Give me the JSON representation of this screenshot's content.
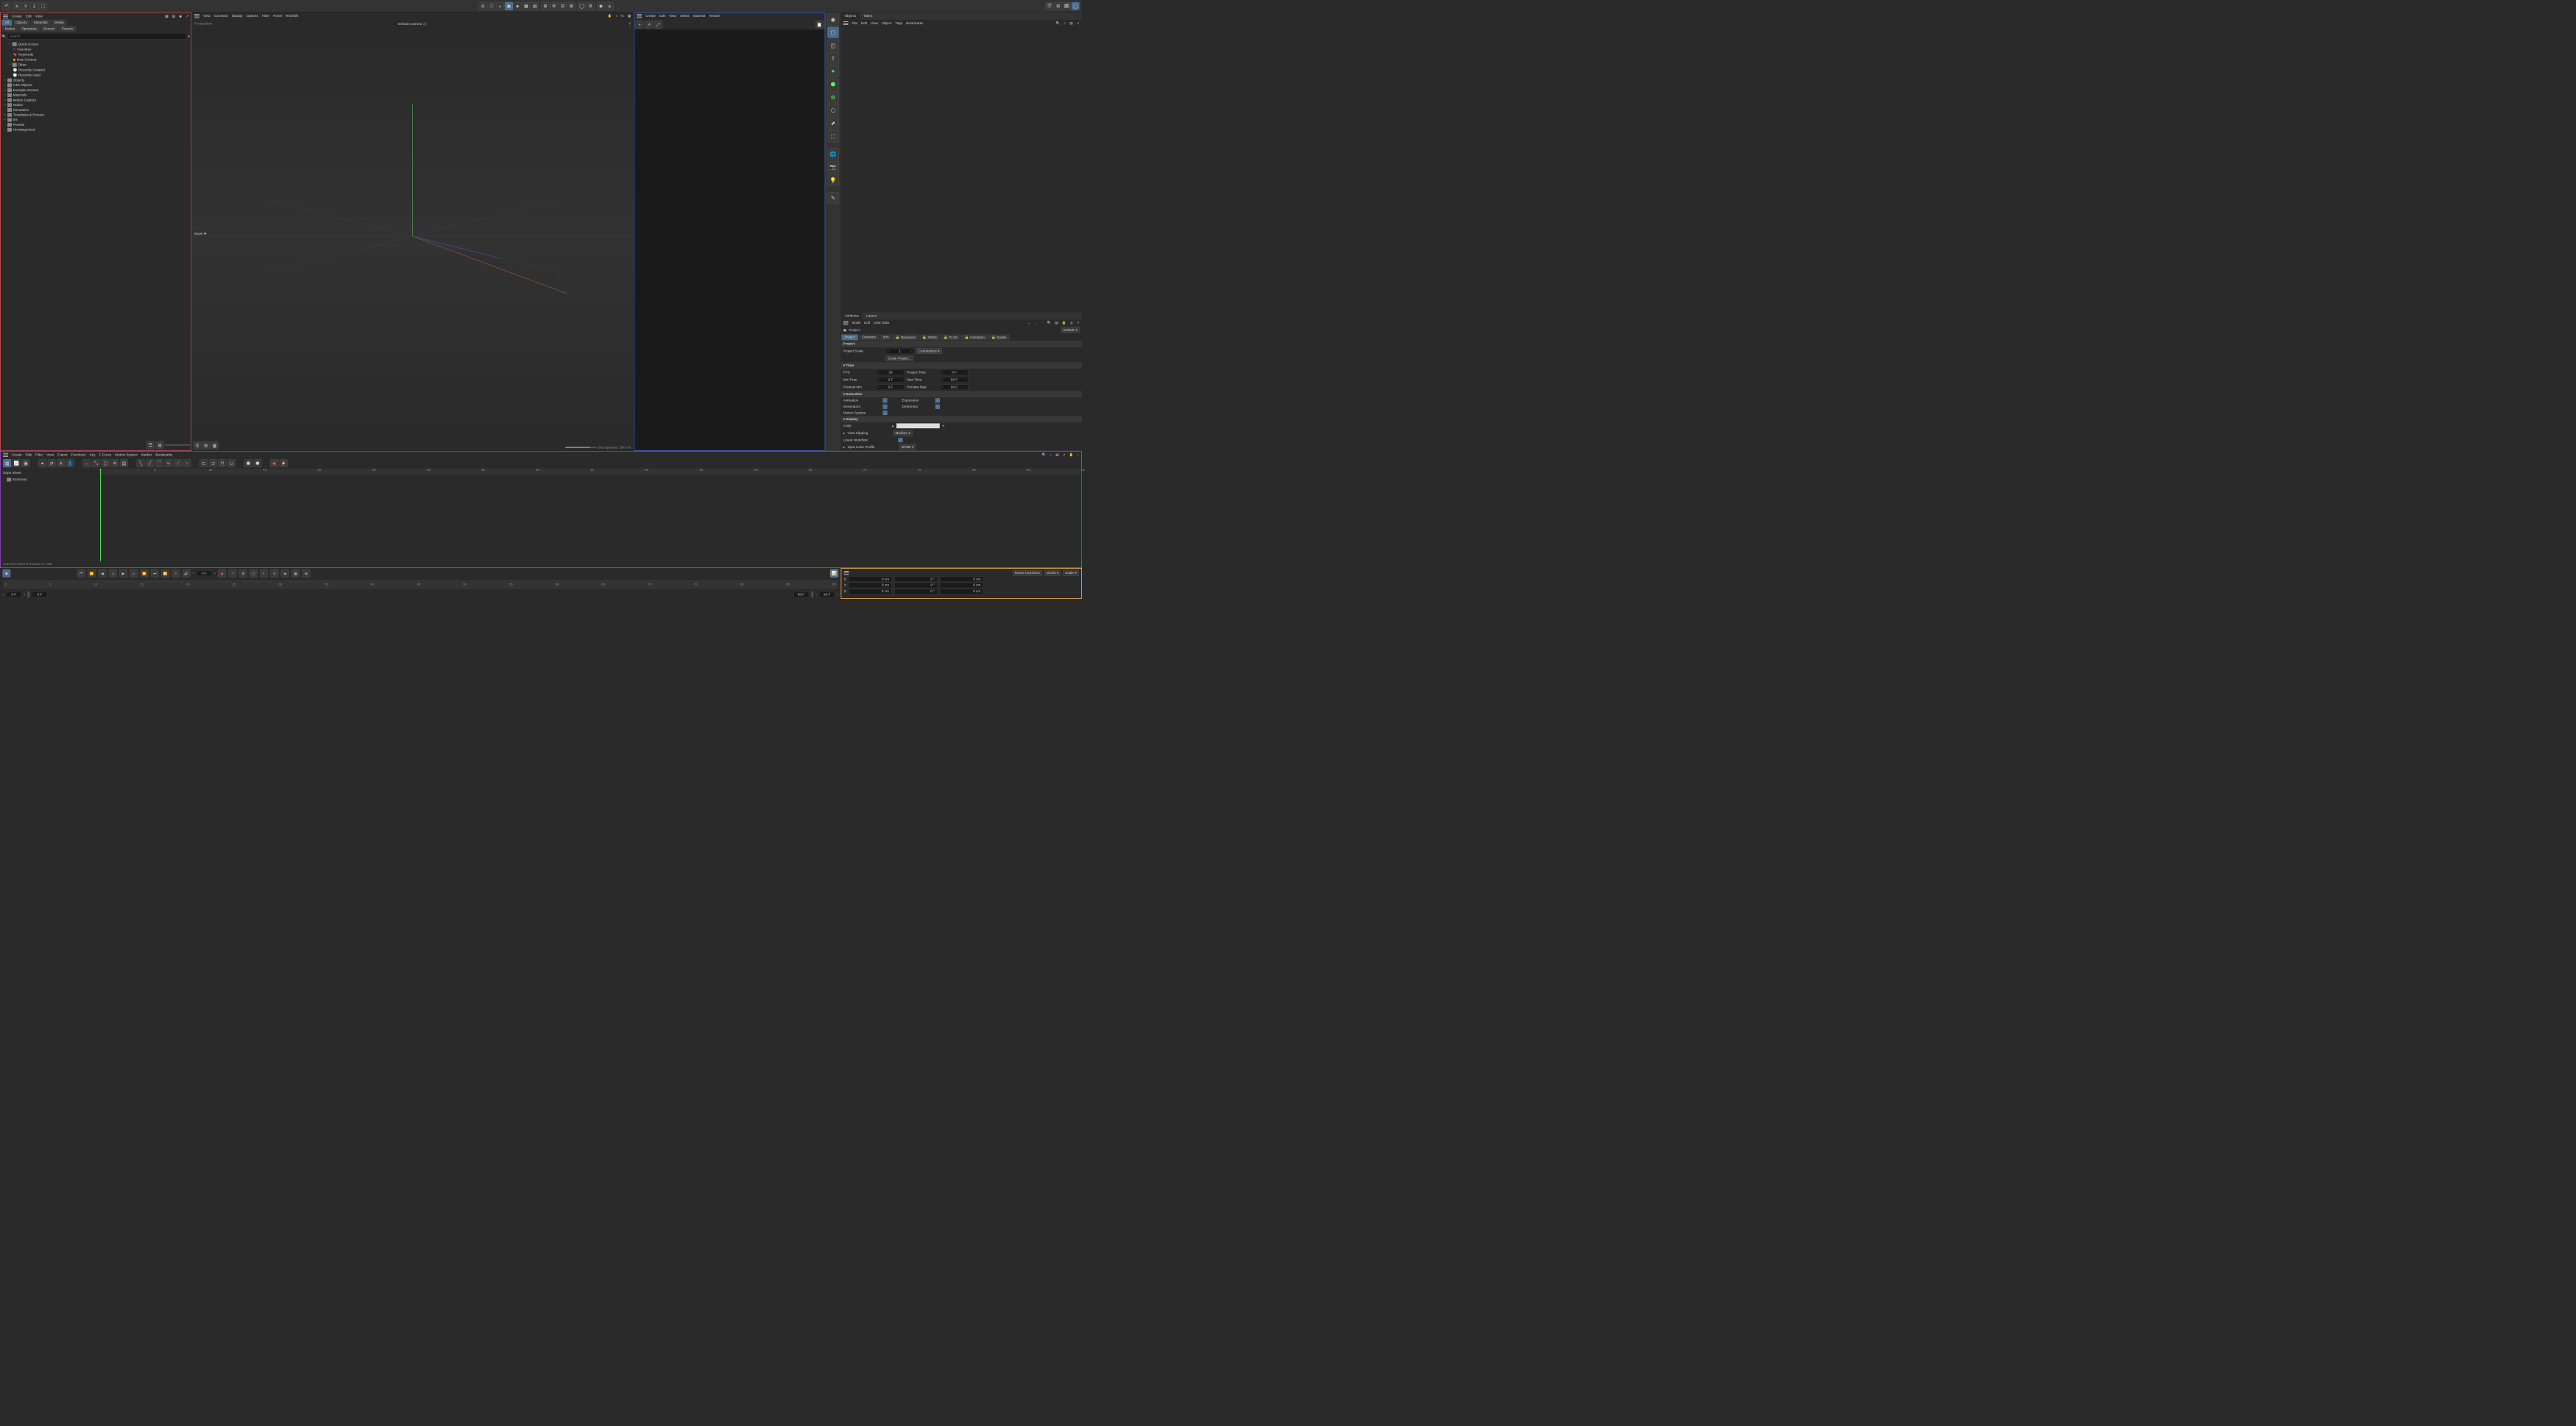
{
  "top_toolbar": {
    "axis_x": "X",
    "axis_y": "Y",
    "axis_z": "Z"
  },
  "asset_browser": {
    "menu": {
      "create": "Create",
      "edit": "Edit",
      "view": "View"
    },
    "tabs_row1": {
      "all": "All",
      "objects": "Objects",
      "materials": "Materials",
      "media": "Media"
    },
    "tabs_row2": {
      "nodes": "Nodes",
      "operators": "Operators",
      "scenes": "Scenes",
      "presets": "Presets"
    },
    "search_placeholder": "Search",
    "tree": {
      "quick_access": "Quick Access",
      "favorites": "Favorites",
      "keywords": "Keywords",
      "new_content": "New Content",
      "other": "Other",
      "recently_created": "Recently Created",
      "recently_used": "Recently Used",
      "objects": "Objects",
      "c4d_objects": "C4D Objects",
      "example_scenes": "Example Scenes",
      "materials": "Materials",
      "motion_capture": "Motion Capture",
      "nodes": "Nodes",
      "simulation": "Simulation",
      "templates": "Templates & Presets",
      "tex": "tex",
      "presets": "Presets",
      "uncategorized": "Uncategorized"
    }
  },
  "viewport": {
    "menu": {
      "view": "View",
      "cameras": "Cameras",
      "display": "Display",
      "options": "Options",
      "filter": "Filter",
      "panel": "Panel",
      "redshift": "Redshift"
    },
    "perspective": "Perspective",
    "camera": "Default Camera",
    "move": "Move",
    "grid_spacing": "Grid Spacing : 500 cm",
    "axis_y": "Y",
    "axis_z": "Z",
    "axis_x": "X"
  },
  "right_viewport": {
    "menu": {
      "create": "Create",
      "edit": "Edit",
      "view": "View",
      "select": "Select",
      "material": "Material",
      "texture": "Texture"
    }
  },
  "object_manager": {
    "tabs": {
      "objects": "Objects",
      "takes": "Takes"
    },
    "menu": {
      "file": "File",
      "edit": "Edit",
      "view": "View",
      "object": "Object",
      "tags": "Tags",
      "bookmarks": "Bookmarks"
    }
  },
  "attributes": {
    "tabs": {
      "attributes": "Attributes",
      "layers": "Layers"
    },
    "menu": {
      "mode": "Mode",
      "edit": "Edit",
      "user_data": "User Data"
    },
    "title": "Project",
    "default": "Default",
    "subtabs": {
      "project": "Project",
      "cineware": "Cineware",
      "info": "Info",
      "dynamics": "Dynamics",
      "xrefs": "XRefs",
      "todo": "To Do",
      "animation": "Animation",
      "nodes": "Nodes"
    },
    "section_project": "Project",
    "project_scale_label": "Project Scale",
    "project_scale_value": "1",
    "project_scale_unit": "Centimeters",
    "scale_project": "Scale Project...",
    "section_time": "Time",
    "fps_label": "FPS",
    "fps_value": "30",
    "project_time_label": "Project Time",
    "project_time_value": "0 F",
    "min_time_label": "Min Time",
    "min_time_value": "0 F",
    "max_time_label": "Max Time",
    "max_time_value": "90 F",
    "preview_min_label": "Preview Min",
    "preview_min_value": "0 F",
    "preview_max_label": "Preview Max",
    "preview_max_value": "90 F",
    "section_execution": "Execution",
    "animation_label": "Animation",
    "expression_label": "Expression",
    "generators_label": "Generators",
    "deformers_label": "Deformers",
    "motion_system_label": "Motion System",
    "section_display": "Display",
    "color_label": "Color",
    "view_clipping_label": "View Clipping",
    "view_clipping_value": "Medium",
    "linear_workflow_label": "Linear Workflow",
    "input_color_label": "Input Color Profile",
    "input_color_value": "sRGB"
  },
  "timeline": {
    "menu": {
      "create": "Create",
      "edit": "Edit",
      "filter": "Filter",
      "view": "View",
      "frame": "Frame",
      "functions": "Functions",
      "key": "Key",
      "fcurve": "F-Curve",
      "motion_system": "Motion System",
      "marker": "Marker",
      "bookmarks": "Bookmarks"
    },
    "dope_sheet": "Dope Sheet",
    "summary": "Summary",
    "ticks": [
      "0",
      "5",
      "10",
      "15",
      "20",
      "25",
      "30",
      "35",
      "40",
      "45",
      "50",
      "55",
      "60",
      "65",
      "70",
      "75",
      "80",
      "85",
      "90"
    ],
    "footer": "Current Frame  0   Preview   0-->90"
  },
  "transport": {
    "frame_field": "0 F",
    "ruler_ticks": [
      "0",
      "5",
      "10",
      "15",
      "20",
      "25",
      "30",
      "35",
      "40",
      "45",
      "50",
      "55",
      "60",
      "65",
      "70",
      "75",
      "80",
      "85",
      "90"
    ],
    "start_frame": "0 F",
    "start_frame2": "0 F",
    "end_frame": "90 F",
    "end_frame2": "90 F"
  },
  "coords": {
    "reset": "Reset Transform",
    "world": "World",
    "scale": "Scale",
    "x_label": "X",
    "y_label": "Y",
    "z_label": "Z",
    "x_pos": "0 cm",
    "y_pos": "0 cm",
    "z_pos": "0 cm",
    "x_rot": "0 °",
    "y_rot": "0 °",
    "z_rot": "0 °",
    "x_scale": "0 cm",
    "y_scale": "0 cm",
    "z_scale": "0 cm"
  }
}
